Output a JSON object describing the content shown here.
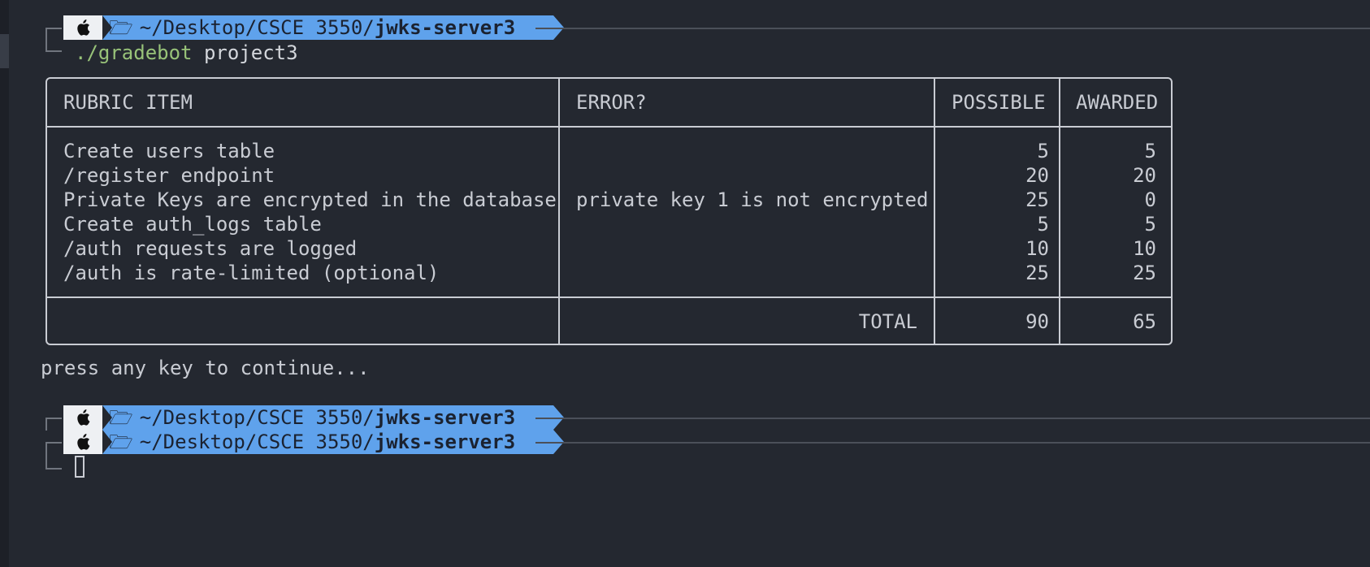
{
  "prompts": [
    {
      "path_prefix": "~/Desktop/CSCE 3550/",
      "path_bold": "jwks-server3"
    },
    {
      "path_prefix": "~/Desktop/CSCE 3550/",
      "path_bold": "jwks-server3"
    },
    {
      "path_prefix": "~/Desktop/CSCE 3550/",
      "path_bold": "jwks-server3"
    }
  ],
  "command": {
    "executable": "./gradebot",
    "argument": "project3"
  },
  "table": {
    "headers": [
      "RUBRIC ITEM",
      "ERROR?",
      "POSSIBLE",
      "AWARDED"
    ],
    "rows": [
      {
        "item": "Create users table",
        "error": "",
        "possible": "5",
        "awarded": "5"
      },
      {
        "item": "/register endpoint",
        "error": "",
        "possible": "20",
        "awarded": "20"
      },
      {
        "item": "Private Keys are encrypted in the database",
        "error": "private key 1 is not encrypted",
        "possible": "25",
        "awarded": "0"
      },
      {
        "item": "Create auth_logs table",
        "error": "",
        "possible": "5",
        "awarded": "5"
      },
      {
        "item": "/auth requests are logged",
        "error": "",
        "possible": "10",
        "awarded": "10"
      },
      {
        "item": "/auth is rate-limited (optional)",
        "error": "",
        "possible": "25",
        "awarded": "25"
      }
    ],
    "footer": {
      "label": "TOTAL",
      "possible": "90",
      "awarded": "65"
    }
  },
  "press_message": "press any key to continue...",
  "icons": {
    "apple": "apple-icon",
    "folder": "folder-icon"
  },
  "colors": {
    "background": "#242830",
    "path_segment": "#5fa2ec",
    "executable": "#98c379"
  }
}
